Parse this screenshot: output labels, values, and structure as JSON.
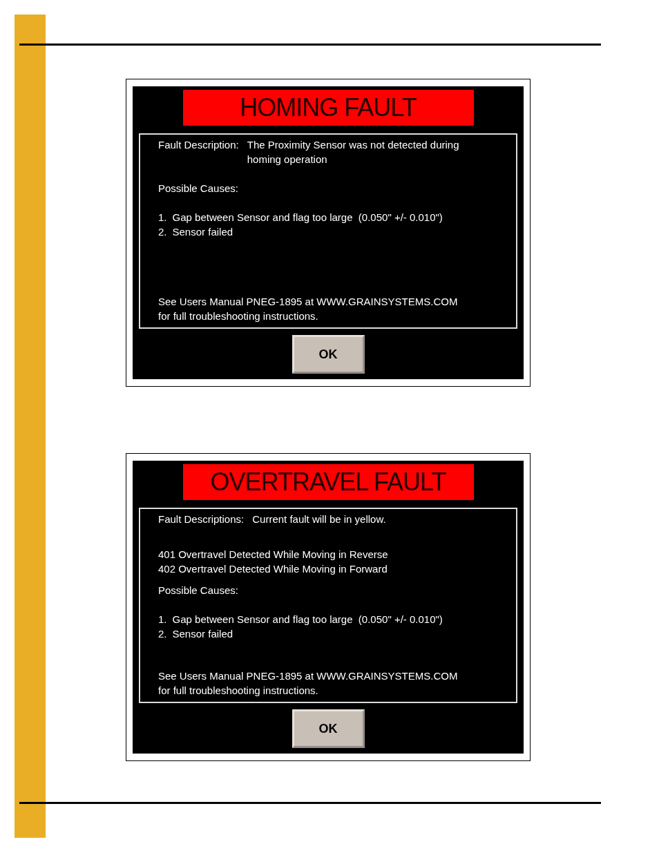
{
  "dialogs": [
    {
      "title": "HOMING FAULT",
      "sections": [
        {
          "kind": "field",
          "label": "Fault Description:",
          "value": "The Proximity Sensor was not detected during homing operation"
        },
        {
          "kind": "heading",
          "text": "Possible Causes:"
        },
        {
          "kind": "numbered",
          "items": [
            {
              "number": "1.",
              "text": "Gap between Sensor and flag too large  (0.050\" +/- 0.010\")"
            },
            {
              "number": "2.",
              "text": "Sensor failed"
            }
          ]
        },
        {
          "kind": "note",
          "lines": [
            "See Users Manual PNEG-1895 at WWW.GRAINSYSTEMS.COM",
            "for full troubleshooting instructions."
          ]
        }
      ],
      "button": "OK"
    },
    {
      "title": "OVERTRAVEL FAULT",
      "sections": [
        {
          "kind": "field",
          "label": "Fault Descriptions:",
          "value": "Current fault will be in yellow."
        },
        {
          "kind": "lines",
          "lines": [
            "401 Overtravel Detected While Moving in Reverse",
            "402 Overtravel Detected While Moving in Forward"
          ]
        },
        {
          "kind": "heading",
          "text": "Possible Causes:"
        },
        {
          "kind": "numbered",
          "items": [
            {
              "number": "1.",
              "text": "Gap between Sensor and flag too large  (0.050\" +/- 0.010\")"
            },
            {
              "number": "2.",
              "text": "Sensor failed"
            }
          ]
        },
        {
          "kind": "note",
          "lines": [
            "See Users Manual PNEG-1895 at WWW.GRAINSYSTEMS.COM",
            "for full troubleshooting instructions."
          ]
        }
      ],
      "button": "OK"
    }
  ]
}
